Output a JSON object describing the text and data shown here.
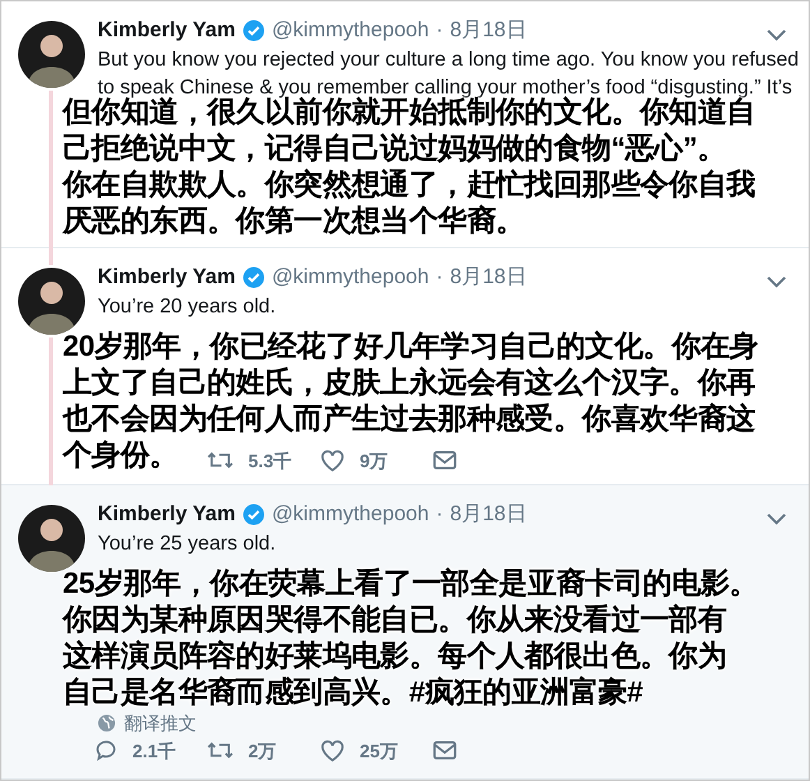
{
  "tweets": [
    {
      "name": "Kimberly Yam",
      "verified": true,
      "handle": "@kimmythepooh",
      "separator": "·",
      "date": "8月18日",
      "focused": false,
      "text_lines": [
        "But you know you rejected your culture a long time ago. You know you refused",
        "to speak Chinese & you remember calling your mother’s food “disgusting.” It’s"
      ],
      "caption_lines": [
        "但你知道，很久以前你就开始抵制你的文化。你知道自",
        "己拒绝说中文，记得自己说过妈妈做的食物“恶心”。",
        "你在自欺欺人。你突然想通了，赶忙找回那些令你自我",
        "厌恶的东西。你第一次想当个华裔。"
      ]
    },
    {
      "name": "Kimberly Yam",
      "verified": true,
      "handle": "@kimmythepooh",
      "separator": "·",
      "date": "8月18日",
      "focused": false,
      "text_lines": [
        "You’re 20 years old."
      ],
      "caption_lines": [
        "20岁那年，你已经花了好几年学习自己的文化。你在身",
        "上文了自己的姓氏，皮肤上永远会有这么个汉字。你再",
        "也不会因为任何人而产生过去那种感受。你喜欢华裔这",
        "个身份。"
      ],
      "actions": [
        {
          "kind": "retweet",
          "count": "5.3千"
        },
        {
          "kind": "like",
          "count": "9万"
        },
        {
          "kind": "mail"
        }
      ]
    },
    {
      "name": "Kimberly Yam",
      "verified": true,
      "handle": "@kimmythepooh",
      "separator": "·",
      "date": "8月18日",
      "focused": true,
      "text_lines": [
        "You’re 25 years old."
      ],
      "caption_lines": [
        "25岁那年，你在荧幕上看了一部全是亚裔卡司的电影。",
        "你因为某种原因哭得不能自已。你从来没看过一部有",
        "这样演员阵容的好莱坞电影。每个人都很出色。你为",
        "自己是名华裔而感到高兴。#疯狂的亚洲富豪#"
      ],
      "translate": "翻译推文",
      "actions": [
        {
          "kind": "reply",
          "count": "2.1千"
        },
        {
          "kind": "retweet",
          "count": "2万"
        },
        {
          "kind": "like",
          "count": "25万"
        },
        {
          "kind": "mail"
        }
      ]
    }
  ]
}
